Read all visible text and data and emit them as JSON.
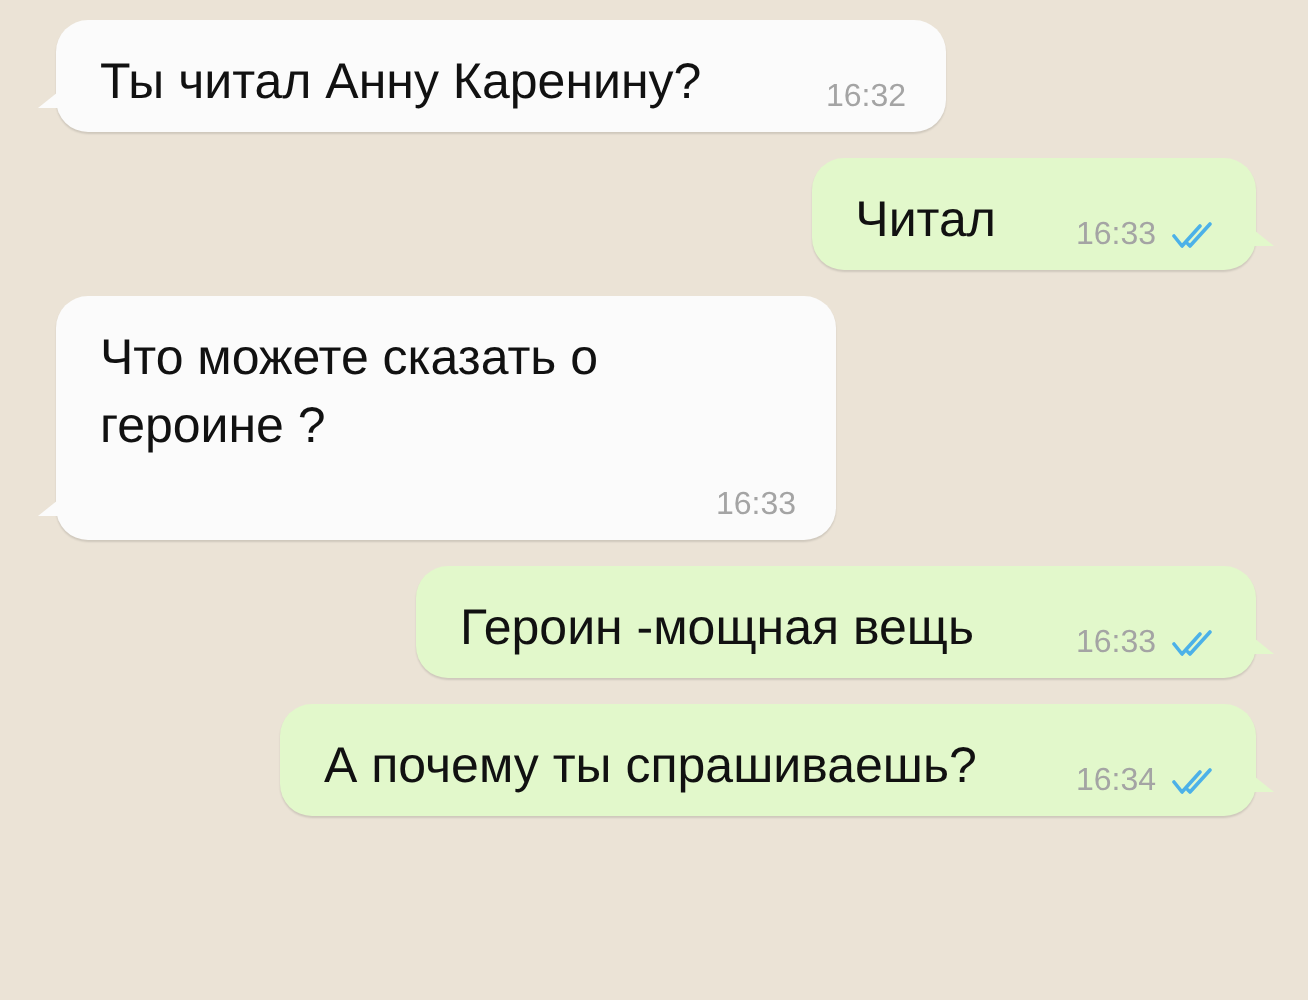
{
  "messages": [
    {
      "kind": "incoming",
      "text": "Ты читал Анну Каренину?",
      "time": "16:32"
    },
    {
      "kind": "outgoing",
      "text": "Читал",
      "time": "16:33",
      "read": true
    },
    {
      "kind": "incoming",
      "text": "Что можете сказать о героине ?",
      "time": "16:33"
    },
    {
      "kind": "outgoing",
      "text": "Героин -мощная вещь",
      "time": "16:33",
      "read": true
    },
    {
      "kind": "outgoing",
      "text": "А почему ты спрашиваешь?",
      "time": "16:34",
      "read": true
    }
  ]
}
